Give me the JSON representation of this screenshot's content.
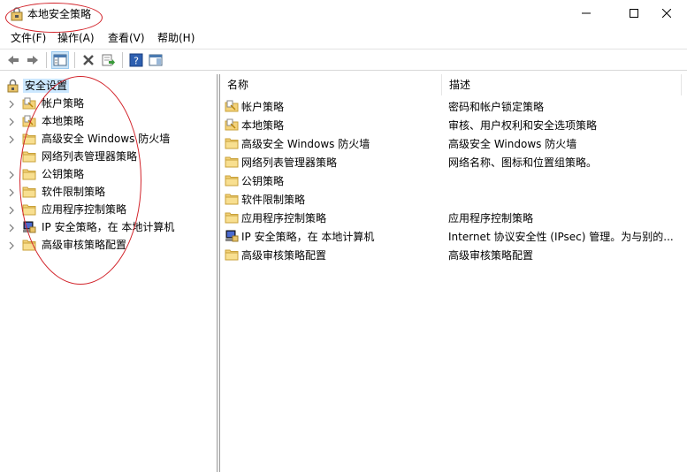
{
  "window": {
    "title": "本地安全策略"
  },
  "menu": [
    {
      "label": "文件(F)"
    },
    {
      "label": "操作(A)"
    },
    {
      "label": "查看(V)"
    },
    {
      "label": "帮助(H)"
    }
  ],
  "tree": {
    "root": "安全设置",
    "items": [
      {
        "label": "帐户策略",
        "icon": "folder-policy-icon"
      },
      {
        "label": "本地策略",
        "icon": "folder-policy-icon"
      },
      {
        "label": "高级安全 Windows 防火墙",
        "icon": "folder-icon"
      },
      {
        "label": "网络列表管理器策略",
        "icon": "folder-icon"
      },
      {
        "label": "公钥策略",
        "icon": "folder-icon"
      },
      {
        "label": "软件限制策略",
        "icon": "folder-icon"
      },
      {
        "label": "应用程序控制策略",
        "icon": "folder-icon"
      },
      {
        "label": "IP 安全策略，在 本地计算机",
        "icon": "ip-security-icon"
      },
      {
        "label": "高级审核策略配置",
        "icon": "folder-icon"
      }
    ]
  },
  "list": {
    "headers": {
      "name": "名称",
      "desc": "描述"
    },
    "rows": [
      {
        "name": "帐户策略",
        "desc": "密码和帐户锁定策略"
      },
      {
        "name": "本地策略",
        "desc": "审核、用户权利和安全选项策略"
      },
      {
        "name": "高级安全 Windows 防火墙",
        "desc": "高级安全 Windows 防火墙"
      },
      {
        "name": "网络列表管理器策略",
        "desc": "网络名称、图标和位置组策略。"
      },
      {
        "name": "公钥策略",
        "desc": ""
      },
      {
        "name": "软件限制策略",
        "desc": ""
      },
      {
        "name": "应用程序控制策略",
        "desc": "应用程序控制策略"
      },
      {
        "name": "IP 安全策略，在 本地计算机",
        "desc": "Internet 协议安全性 (IPsec) 管理。为与别的..."
      },
      {
        "name": "高级审核策略配置",
        "desc": "高级审核策略配置"
      }
    ]
  },
  "colors": {
    "selection": "#cce8ff",
    "annotation": "#d2232a",
    "folder": "#f4d27a"
  }
}
